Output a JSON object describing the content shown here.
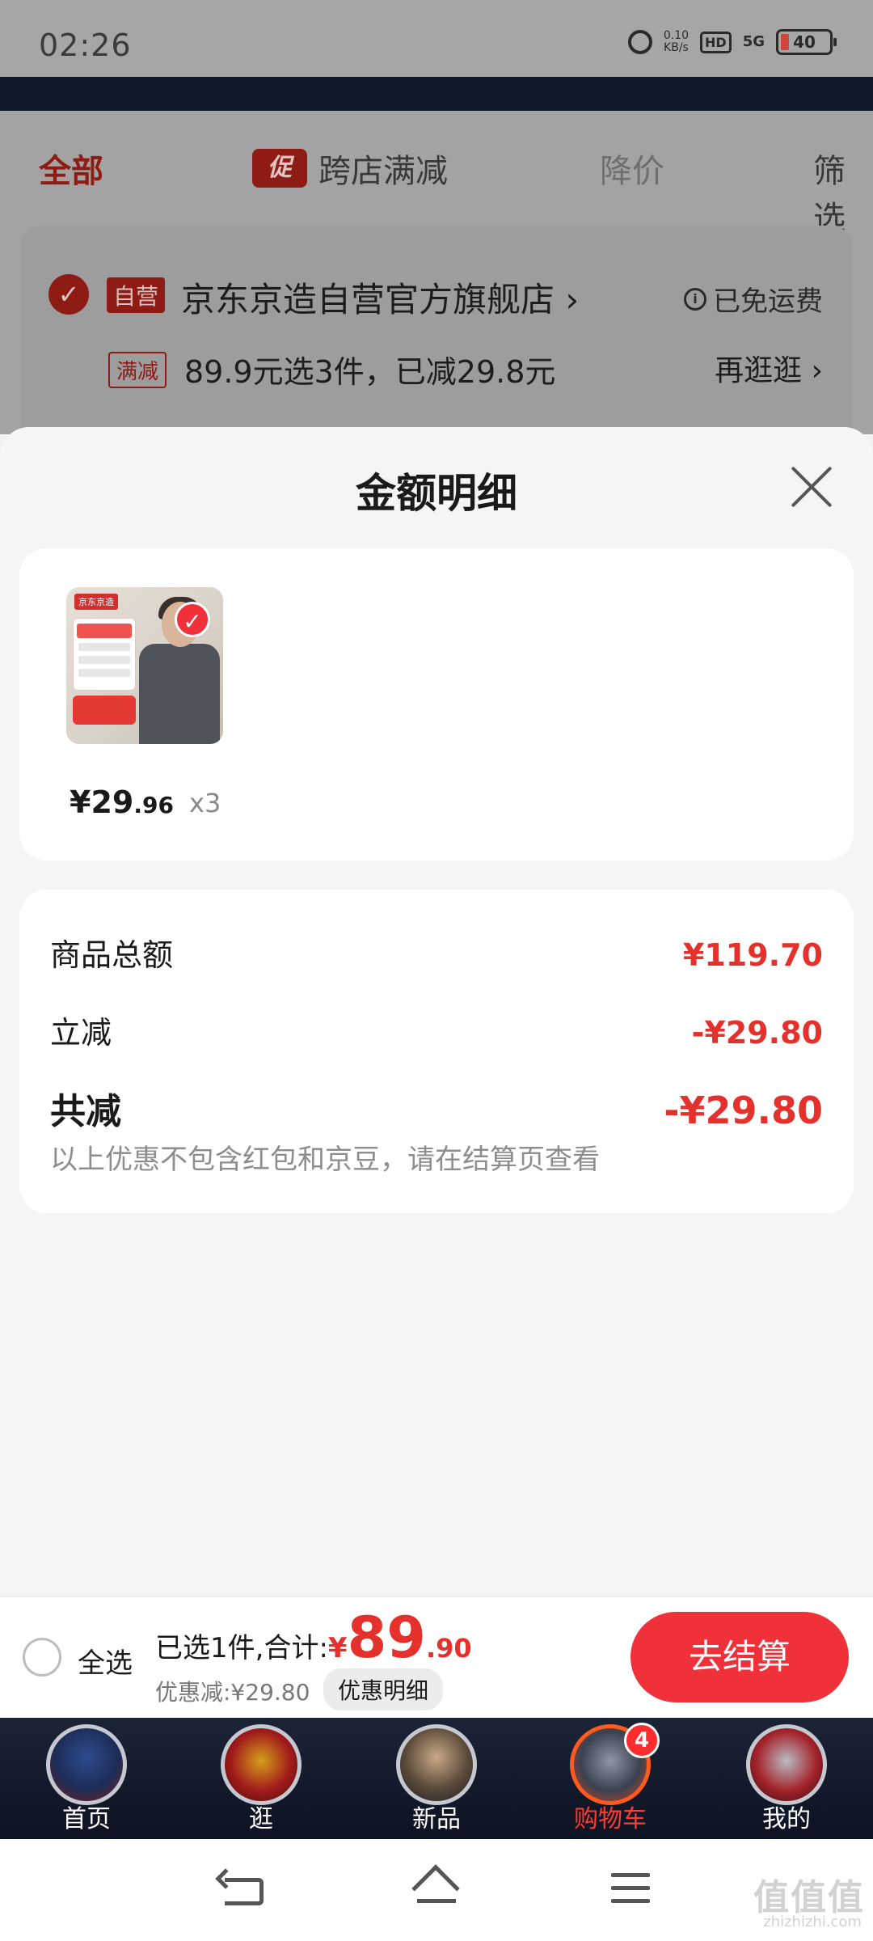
{
  "status_bar": {
    "time": "02:26",
    "net_speed_top": "0.10",
    "net_speed_bottom": "KB/s",
    "hd": "HD",
    "signal": "5G",
    "battery": "40"
  },
  "background": {
    "tabs": {
      "all": "全部",
      "promo_badge": "促",
      "promo": "跨店满减",
      "price_drop": "降价",
      "filter": "筛选"
    },
    "shop": {
      "self_badge": "自营",
      "name": "京东京造自营官方旗舰店 ›",
      "free_shipping": "已免运费",
      "promo_badge": "满减",
      "promo_text": "89.9元选3件，已减29.8元",
      "browse_more": "再逛逛 ›"
    }
  },
  "sheet": {
    "title": "金额明细",
    "item": {
      "brand_tag": "京东京造",
      "price_int": "¥29",
      "price_dec": ".96",
      "qty": "x3"
    },
    "summary": {
      "subtotal_label": "商品总额",
      "subtotal_value": "¥119.70",
      "instant_label": "立减",
      "instant_value": "-¥29.80",
      "total_label": "共减",
      "total_value": "-¥29.80",
      "note": "以上优惠不包含红包和京豆，请在结算页查看"
    }
  },
  "checkout": {
    "select_all": "全选",
    "summary_prefix": "已选1件,合计:",
    "currency": "¥",
    "amount_int": "89",
    "amount_dec": ".90",
    "discount": "优惠减:¥29.80",
    "detail_button": "优惠明细",
    "checkout_button": "去结算"
  },
  "tab_bar": {
    "items": [
      {
        "label": "首页",
        "icon": "captain-america-avatar-icon"
      },
      {
        "label": "逛",
        "icon": "iron-man-avatar-icon"
      },
      {
        "label": "新品",
        "icon": "thor-avatar-icon"
      },
      {
        "label": "购物车",
        "icon": "war-machine-avatar-icon",
        "badge": "4"
      },
      {
        "label": "我的",
        "icon": "ant-man-avatar-icon"
      }
    ],
    "active_color": "#ff3b30"
  },
  "watermark": {
    "main": "值值值",
    "sub": "zhizhizhi.com"
  },
  "colors": {
    "accent": "#e4312b",
    "checkout_button": "#f0313a"
  }
}
